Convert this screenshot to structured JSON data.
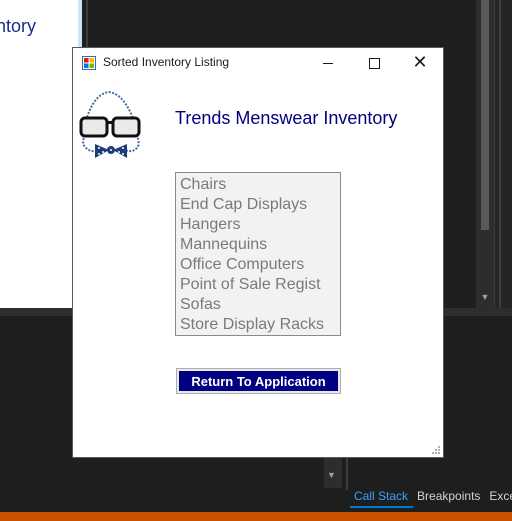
{
  "background_ide": {
    "left_panel_text": "ntory",
    "tabs": [
      {
        "label": "Call Stack",
        "active": true
      },
      {
        "label": "Breakpoints",
        "active": false
      },
      {
        "label": "Exce",
        "active": false
      }
    ],
    "accent_color": "#007acc",
    "status_color": "#ca5100"
  },
  "dialog": {
    "title": "Sorted Inventory Listing",
    "app_icon": "windows-form-icon",
    "controls": {
      "minimize": "minimize-icon",
      "maximize": "maximize-icon",
      "close": "close-icon"
    },
    "logo": "glasses-bowtie-logo",
    "heading": "Trends Menswear Inventory",
    "heading_color": "#000080",
    "inventory_items": [
      "Chairs",
      "End Cap Displays",
      "Hangers",
      "Mannequins",
      "Office Computers",
      "Point of Sale Regist",
      "Sofas",
      "Store Display Racks"
    ],
    "return_button_label": "Return To Application",
    "return_button_color": "#000080"
  }
}
